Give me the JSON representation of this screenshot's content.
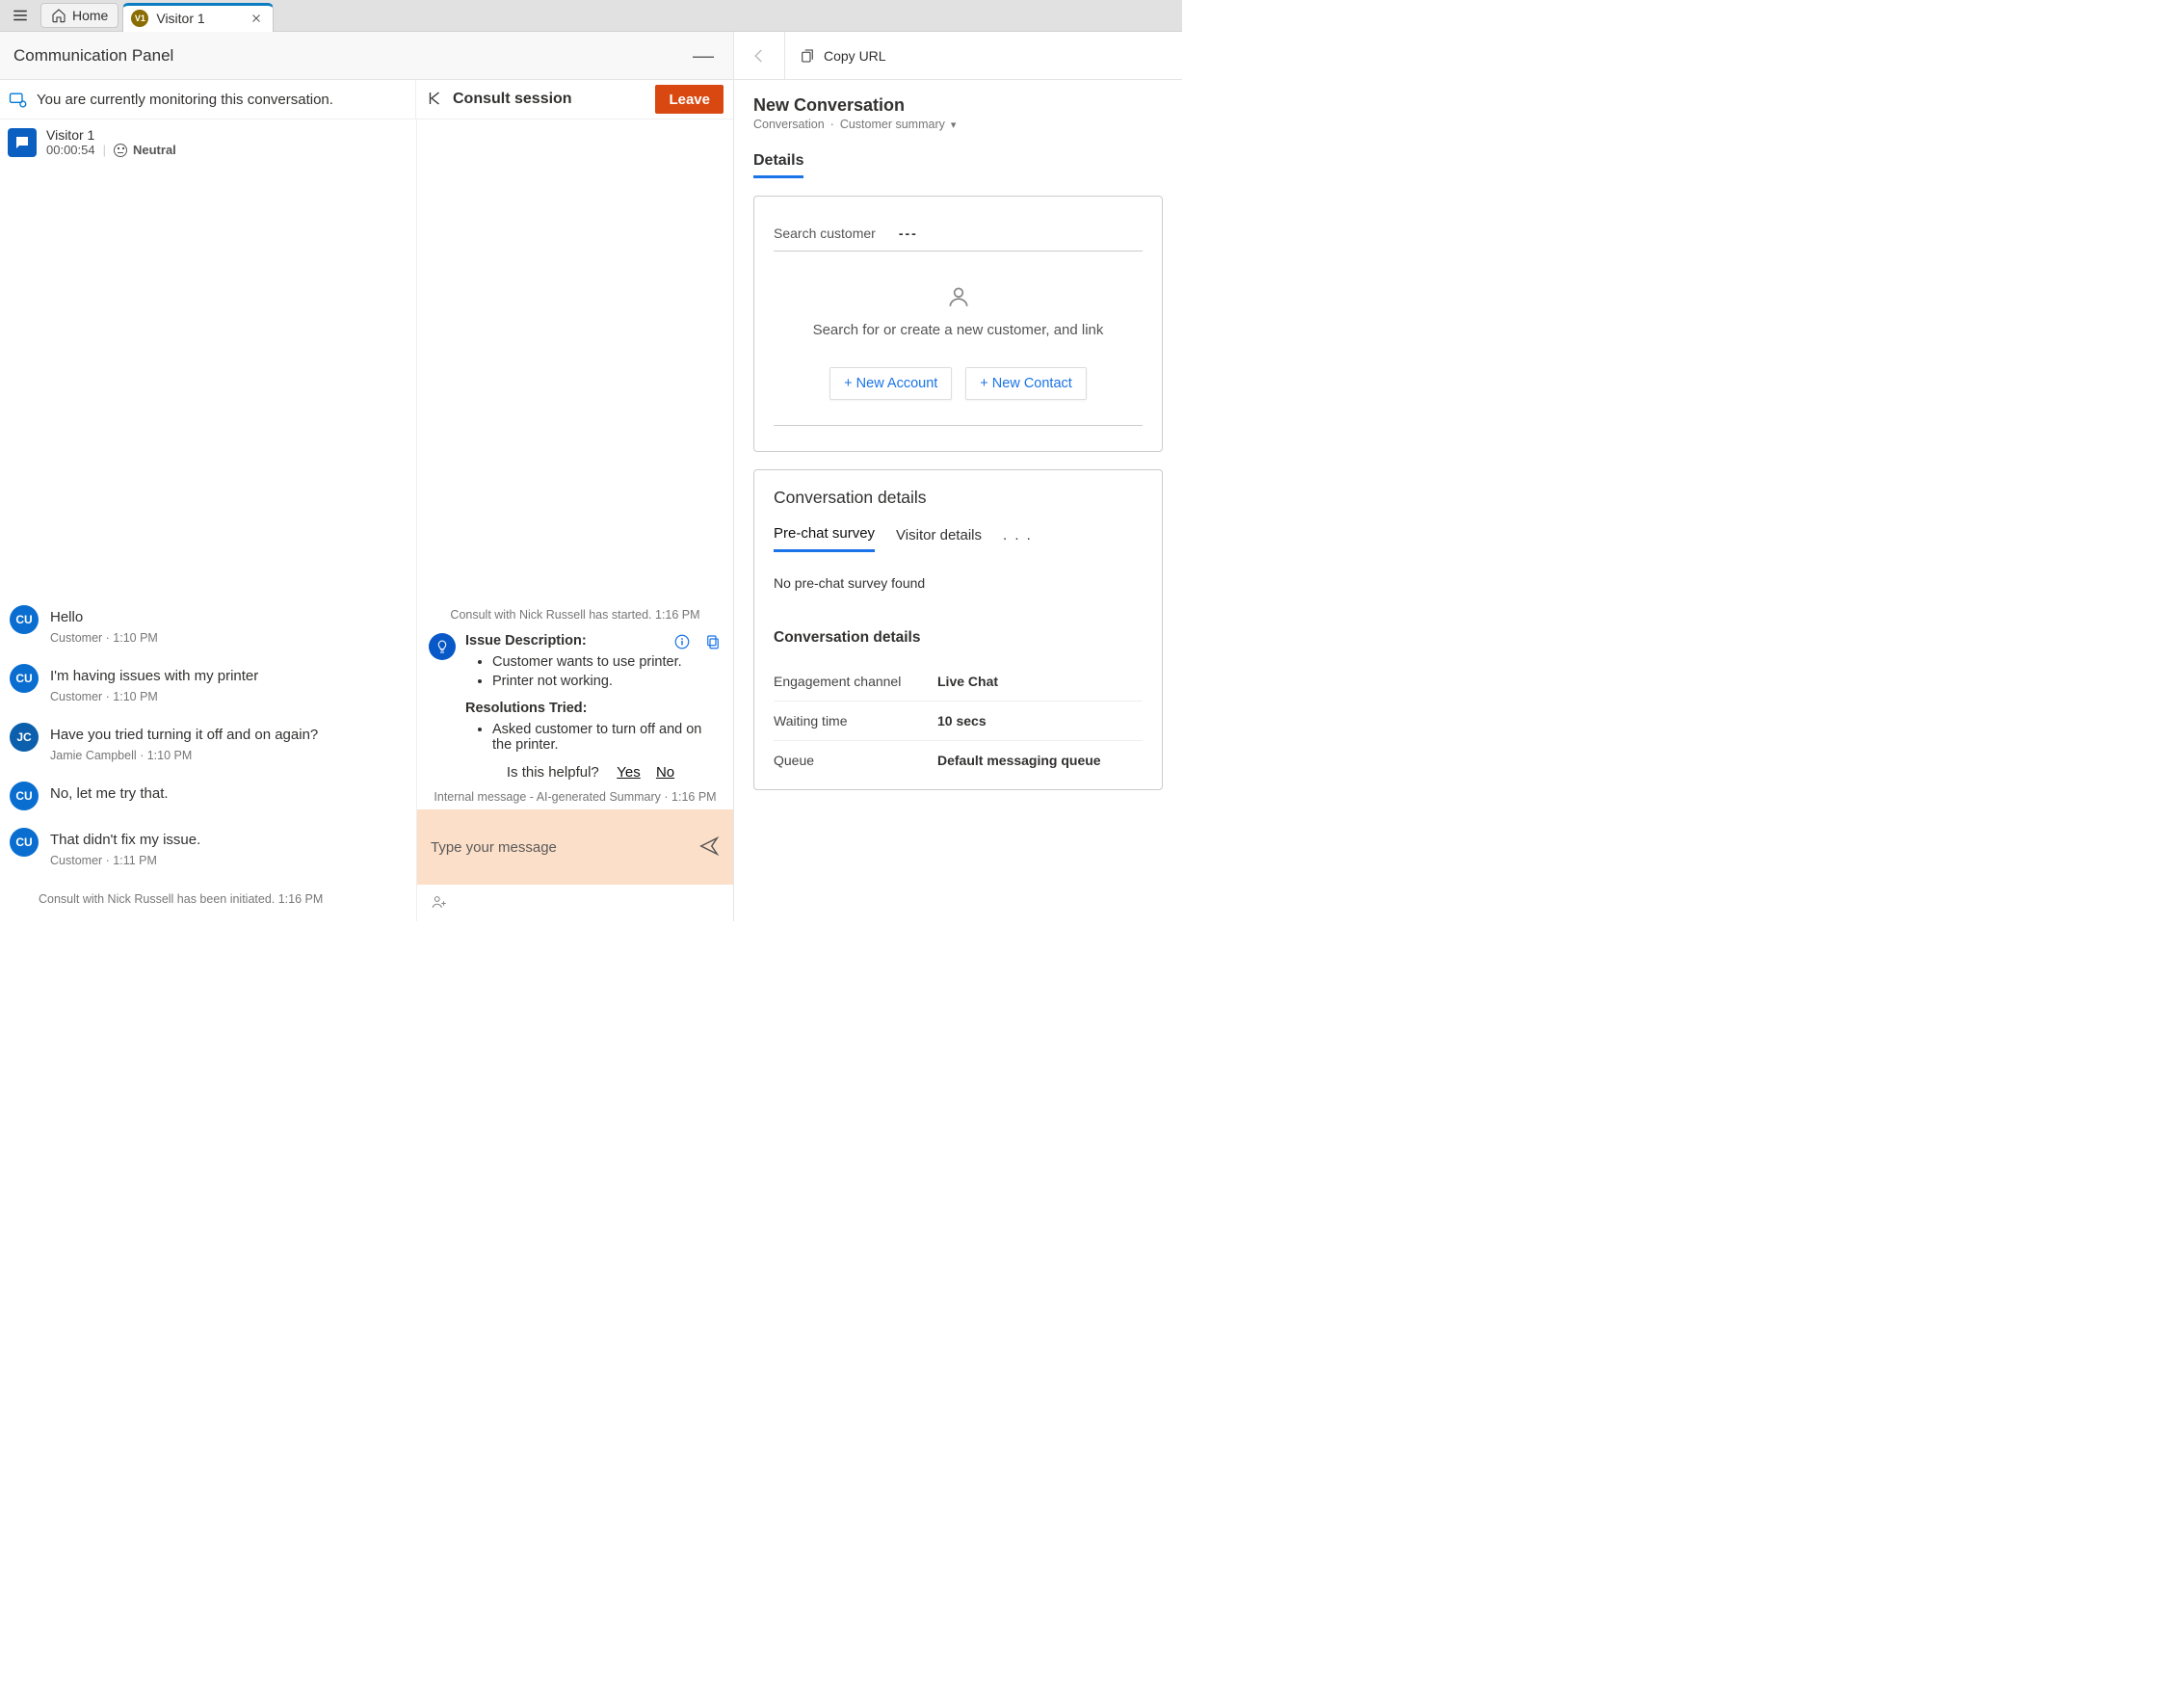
{
  "tabbar": {
    "home_label": "Home",
    "tab_avatar_initials": "V1",
    "tab_label": "Visitor 1"
  },
  "comm_panel_title": "Communication Panel",
  "monitoring_msg": "You are currently monitoring this conversation.",
  "consult_session_label": "Consult session",
  "leave_label": "Leave",
  "session": {
    "name": "Visitor 1",
    "timer": "00:00:54",
    "sentiment": "Neutral"
  },
  "chat": {
    "messages": [
      {
        "avatar": "CU",
        "text": "Hello",
        "meta": "Customer · 1:10 PM"
      },
      {
        "avatar": "CU",
        "text": "I'm having issues with my printer",
        "meta": "Customer · 1:10 PM"
      },
      {
        "avatar": "JC",
        "text": "Have you tried turning it off and on again?",
        "meta": "Jamie Campbell · 1:10 PM"
      },
      {
        "avatar": "CU",
        "text": "No, let me try that.",
        "meta": ""
      },
      {
        "avatar": "CU",
        "text": "That didn't fix my issue.",
        "meta": "Customer · 1:11 PM"
      }
    ],
    "consult_initiated": "Consult with Nick Russell has been initiated. 1:16 PM"
  },
  "consult": {
    "started": "Consult with Nick Russell has started. 1:16 PM",
    "issue_desc_label": "Issue Description:",
    "issue_items": [
      "Customer wants to use printer.",
      "Printer not working."
    ],
    "res_label": "Resolutions Tried:",
    "res_items": [
      "Asked customer to turn off and on the printer."
    ],
    "helpful_q": "Is this helpful?",
    "helpful_yes": "Yes",
    "helpful_no": "No",
    "ai_footer": "Internal message - AI-generated Summary · 1:16 PM",
    "compose_placeholder": "Type your message"
  },
  "right": {
    "copy_url": "Copy URL",
    "page_title": "New Conversation",
    "breadcrumb_parent": "Conversation",
    "breadcrumb_current": "Customer summary",
    "details_tab": "Details",
    "search_label": "Search customer",
    "search_value": "---",
    "empty_text": "Search for or create a new customer, and link",
    "new_account": "+ New Account",
    "new_contact": "+ New Contact",
    "conv_details_header": "Conversation details",
    "subtabs": {
      "prechat": "Pre-chat survey",
      "visitor": "Visitor details",
      "more": ". . ."
    },
    "survey_empty": "No pre-chat survey found",
    "conv_details_subhead": "Conversation details",
    "kv": [
      {
        "k": "Engagement channel",
        "v": "Live Chat"
      },
      {
        "k": "Waiting time",
        "v": "10 secs"
      },
      {
        "k": "Queue",
        "v": "Default messaging queue"
      }
    ]
  }
}
